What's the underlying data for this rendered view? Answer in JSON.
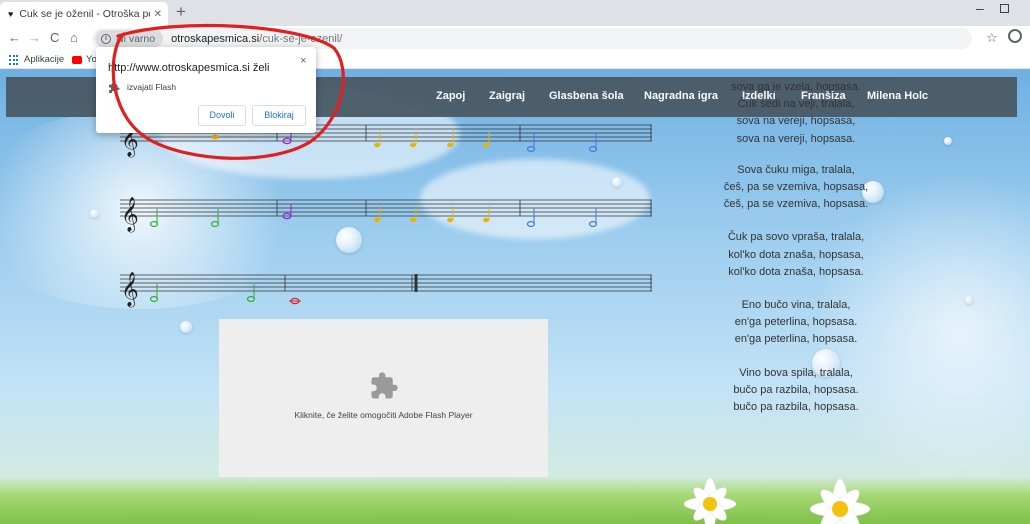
{
  "browser": {
    "tab": {
      "title": "Cuk se je oženil - Otroška pesmic",
      "close": "✕"
    },
    "new_tab": "+",
    "url": {
      "security": "Ni varno",
      "host": "otroskapesmica.si",
      "path": "/cuk-se-je-ozenil/"
    },
    "bookmarks": [
      {
        "label": "Aplikacije"
      },
      {
        "label": "Yo"
      }
    ]
  },
  "permission_popup": {
    "title": "http://www.otroskapesmica.si želi",
    "description": "izvajati Flash",
    "allow": "Dovoli",
    "block": "Blokiraj",
    "close": "×"
  },
  "navbar": {
    "items": [
      {
        "label": "Zapoj"
      },
      {
        "label": "Zaigraj"
      },
      {
        "label": "Glasbena šola"
      },
      {
        "label": "Nagradna igra"
      },
      {
        "label": "Izdelki"
      },
      {
        "label": "Franšiza"
      },
      {
        "label": "Milena Holc"
      }
    ]
  },
  "lyrics": {
    "stanzas": [
      [
        "sova ga je vzela, hopsasa.",
        "Čuk sedi na veji, tralala,",
        "sova na vereji, hopsasa,",
        "sova na vereji, hopsasa."
      ],
      [
        "Sova čuku miga, tralala,",
        "češ, pa se vzemiva, hopsasa,",
        "češ, pa se vzemiva, hopsasa."
      ],
      [
        "Čuk pa sovo vpraša, tralala,",
        "kol'ko dota znaša, hopsasa,",
        "kol'ko dota znaša, hopsasa."
      ],
      [
        "Eno bučo vina, tralala,",
        "en'ga peterlina, hopsasa.",
        "en'ga peterlina, hopsasa."
      ],
      [
        "Vino bova spila, tralala,",
        "bučo pa razbila, hopsasa.",
        "bučo pa razbila, hopsasa."
      ]
    ]
  },
  "flash_placeholder": {
    "text": "Kliknite, če želite omogočiti Adobe Flash Player"
  },
  "colors": {
    "note_green": "#33aa33",
    "note_yellow": "#e8b400",
    "note_blue": "#4477dd",
    "note_purple": "#9922cc",
    "note_red": "#dd2222",
    "annotation_red": "#e02020",
    "navbar": "#4a5a66"
  }
}
